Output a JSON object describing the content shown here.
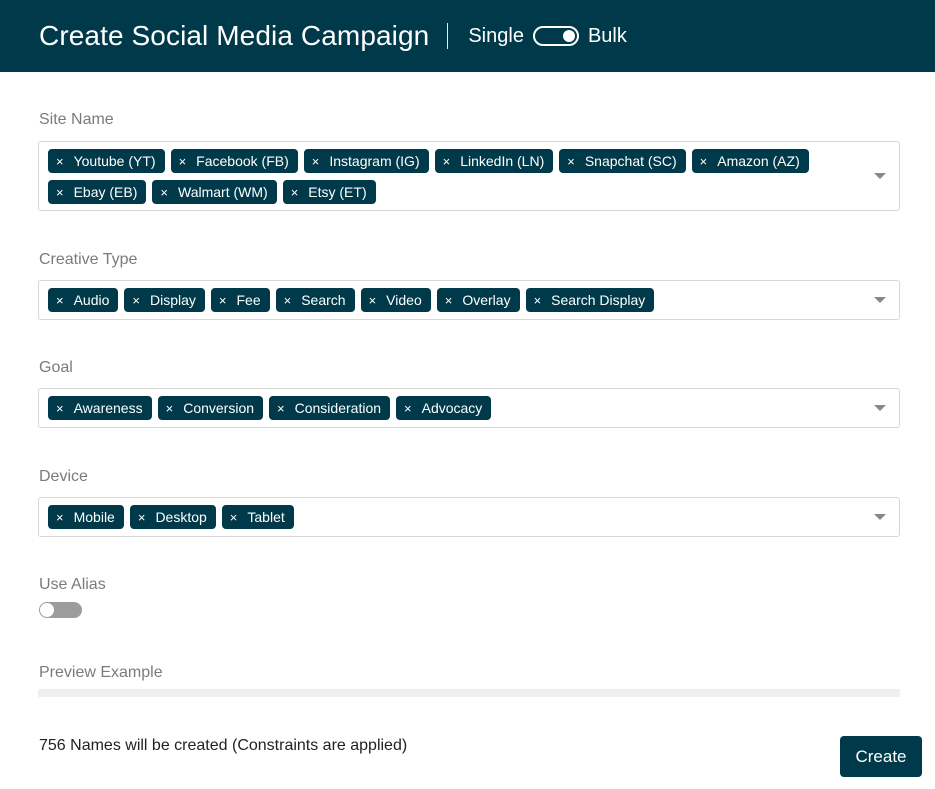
{
  "header": {
    "title": "Create Social Media Campaign",
    "mode_left": "Single",
    "mode_right": "Bulk"
  },
  "site_name": {
    "label": "Site Name",
    "chips": [
      "Youtube (YT)",
      "Facebook (FB)",
      "Instagram (IG)",
      "LinkedIn (LN)",
      "Snapchat (SC)",
      "Amazon (AZ)",
      "Ebay (EB)",
      "Walmart (WM)",
      "Etsy (ET)"
    ]
  },
  "creative_type": {
    "label": "Creative Type",
    "chips": [
      "Audio",
      "Display",
      "Fee",
      "Search",
      "Video",
      "Overlay",
      "Search Display"
    ]
  },
  "goal": {
    "label": "Goal",
    "chips": [
      "Awareness",
      "Conversion",
      "Consideration",
      "Advocacy"
    ]
  },
  "device": {
    "label": "Device",
    "chips": [
      "Mobile",
      "Desktop",
      "Tablet"
    ]
  },
  "use_alias": {
    "label": "Use Alias",
    "enabled": false
  },
  "preview": {
    "label": "Preview Example"
  },
  "footer": {
    "names_count": "756 Names will be created (Constraints are applied)",
    "create_label": "Create"
  },
  "colors": {
    "primary": "#003a4a",
    "label_gray": "#7b7b7b",
    "border": "#d6d6d6"
  },
  "chip_remove_glyph": "×"
}
